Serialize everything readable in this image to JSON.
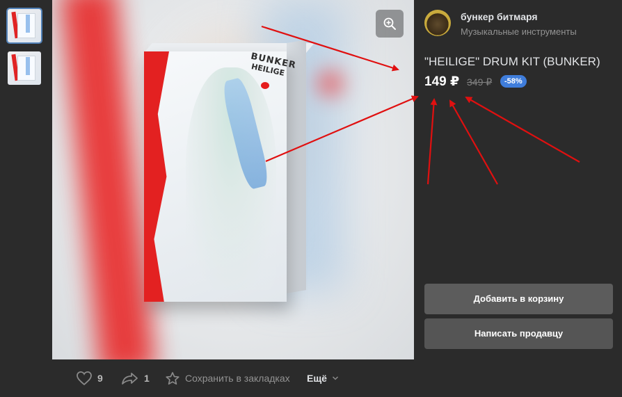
{
  "seller": {
    "name": "бункер битмаря",
    "category": "Музыкальные инструменты"
  },
  "product": {
    "title": "\"HEILIGE\" DRUM KIT (BUNKER)",
    "price": "149 ₽",
    "old_price": "349 ₽",
    "discount": "-58%",
    "box_logo_line1": "BUNKER",
    "box_logo_line2": "HEILIGE"
  },
  "buttons": {
    "add_to_cart": "Добавить в корзину",
    "message_seller": "Написать продавцу"
  },
  "actions": {
    "likes": "9",
    "shares": "1",
    "save": "Сохранить в закладках",
    "more": "Ещё"
  },
  "colors": {
    "background": "#2b2b2b",
    "button": "#5c5c5c",
    "discount_badge": "#3f7ddb",
    "annotation_arrows": "#e01010"
  },
  "icons": [
    "zoom-in-icon",
    "heart-icon",
    "share-icon",
    "star-icon",
    "chevron-down-icon"
  ]
}
